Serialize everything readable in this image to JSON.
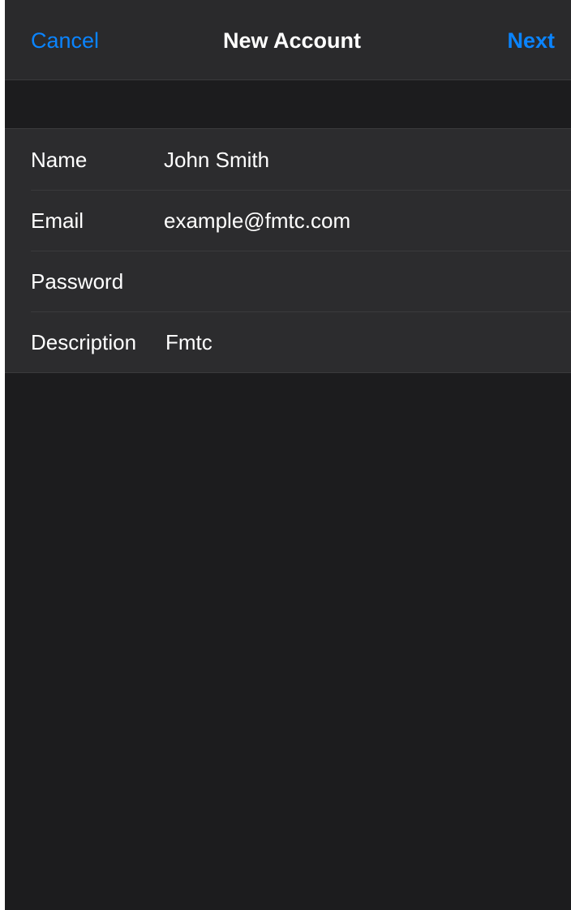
{
  "nav": {
    "cancel_label": "Cancel",
    "title": "New Account",
    "next_label": "Next"
  },
  "form": {
    "name": {
      "label": "Name",
      "value": "John Smith"
    },
    "email": {
      "label": "Email",
      "value": "example@fmtc.com"
    },
    "password": {
      "label": "Password",
      "value": ""
    },
    "description": {
      "label": "Description",
      "value": "Fmtc"
    }
  },
  "colors": {
    "accent": "#0a84ff",
    "background": "#1c1c1e",
    "nav_background": "#2a2a2c",
    "cell_background": "#2c2c2e",
    "separator": "#3a3a3c",
    "text": "#ffffff"
  }
}
